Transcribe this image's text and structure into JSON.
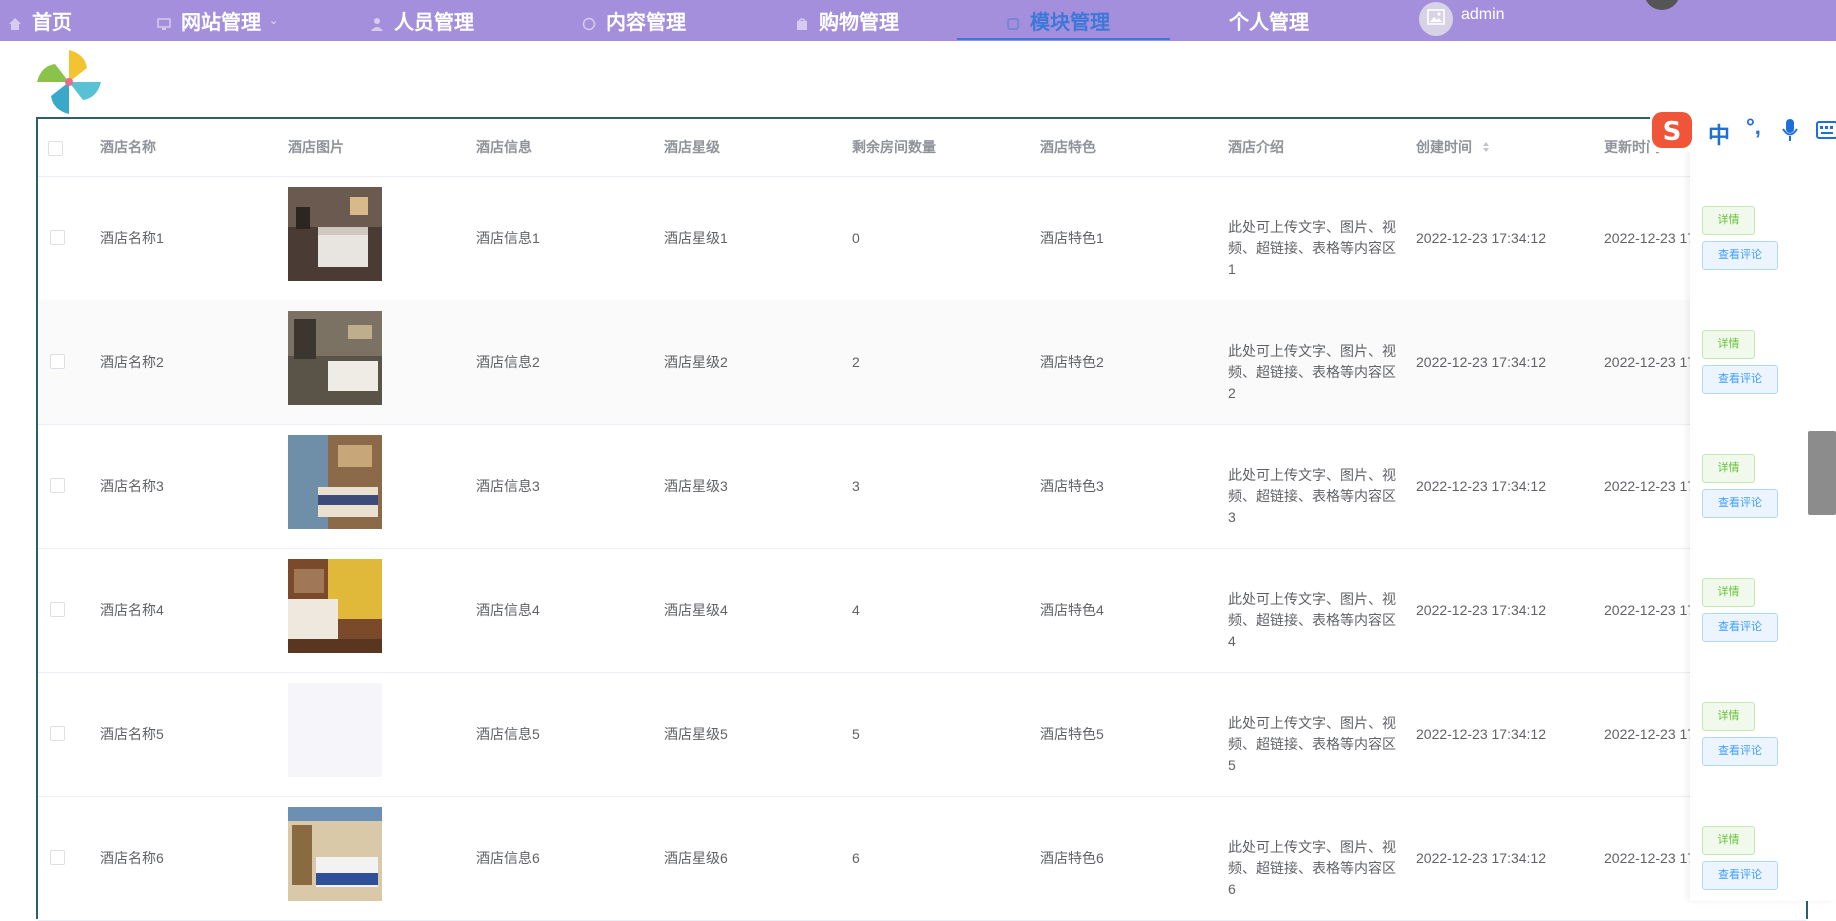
{
  "nav": {
    "items": [
      {
        "label": "首页",
        "icon": "home-icon"
      },
      {
        "label": "网站管理",
        "icon": "monitor-icon"
      },
      {
        "label": "人员管理",
        "icon": "user-icon"
      },
      {
        "label": "内容管理",
        "icon": "document-icon"
      },
      {
        "label": "购物管理",
        "icon": "shopping-icon"
      },
      {
        "label": "模块管理",
        "icon": "module-icon",
        "active": true
      },
      {
        "label": "个人管理"
      }
    ],
    "user_name": "admin",
    "active_color": "#3c78d8",
    "bar_color": "#a48fdc"
  },
  "table": {
    "headers": {
      "name": "酒店名称",
      "image": "酒店图片",
      "info": "酒店信息",
      "star": "酒店星级",
      "rooms": "剩余房间数量",
      "feature": "酒店特色",
      "intro": "酒店介绍",
      "created": "创建时间",
      "updated": "更新时间"
    },
    "rows": [
      {
        "name": "酒店名称1",
        "info": "酒店信息1",
        "star": "酒店星级1",
        "rooms": "0",
        "feature": "酒店特色1",
        "intro_line1": "此处可上传文字、图片、视",
        "intro_line2": "频、超链接、表格等内容区1",
        "created": "2022-12-23 17:34:12",
        "updated": "2022-12-23 17"
      },
      {
        "name": "酒店名称2",
        "info": "酒店信息2",
        "star": "酒店星级2",
        "rooms": "2",
        "feature": "酒店特色2",
        "intro_line1": "此处可上传文字、图片、视",
        "intro_line2": "频、超链接、表格等内容区2",
        "created": "2022-12-23 17:34:12",
        "updated": "2022-12-23 17"
      },
      {
        "name": "酒店名称3",
        "info": "酒店信息3",
        "star": "酒店星级3",
        "rooms": "3",
        "feature": "酒店特色3",
        "intro_line1": "此处可上传文字、图片、视",
        "intro_line2": "频、超链接、表格等内容区3",
        "created": "2022-12-23 17:34:12",
        "updated": "2022-12-23 17"
      },
      {
        "name": "酒店名称4",
        "info": "酒店信息4",
        "star": "酒店星级4",
        "rooms": "4",
        "feature": "酒店特色4",
        "intro_line1": "此处可上传文字、图片、视",
        "intro_line2": "频、超链接、表格等内容区4",
        "created": "2022-12-23 17:34:12",
        "updated": "2022-12-23 17"
      },
      {
        "name": "酒店名称5",
        "info": "酒店信息5",
        "star": "酒店星级5",
        "rooms": "5",
        "feature": "酒店特色5",
        "intro_line1": "此处可上传文字、图片、视",
        "intro_line2": "频、超链接、表格等内容区5",
        "created": "2022-12-23 17:34:12",
        "updated": "2022-12-23 17"
      },
      {
        "name": "酒店名称6",
        "info": "酒店信息6",
        "star": "酒店星级6",
        "rooms": "6",
        "feature": "酒店特色6",
        "intro_line1": "此处可上传文字、图片、视",
        "intro_line2": "频、超链接、表格等内容区6",
        "created": "2022-12-23 17:34:12",
        "updated": "2022-12-23 17"
      }
    ],
    "actions": {
      "detail": "详情",
      "review": "查看评论"
    }
  },
  "ime": {
    "lang_label": "中",
    "punct_label": "°,"
  }
}
